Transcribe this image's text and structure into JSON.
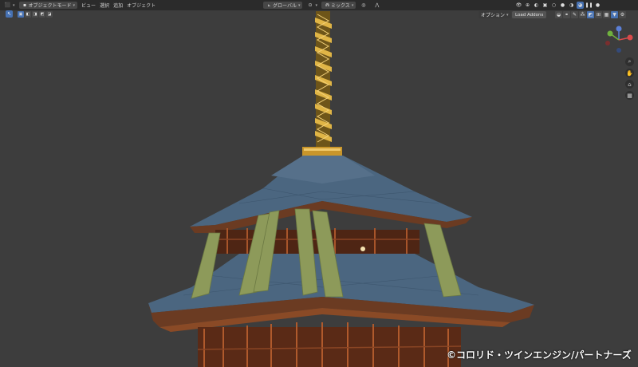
{
  "header": {
    "mode_label": "オブジェクトモード",
    "menus": [
      "ビュー",
      "選択",
      "追加",
      "オブジェクト"
    ],
    "transform_orientation": "グローバル",
    "snap_label": "ミックス"
  },
  "toolbar": {
    "options_label": "オプション",
    "load_addons_label": "Load Addons"
  },
  "watermark": {
    "copyright": "©コロリド・ツインエンジン/パートナーズ"
  },
  "colors": {
    "viewport_bg": "#3d3d3d",
    "header_bg": "#2b2b2b",
    "active_blue": "#4772b3",
    "roof_tile": "#4b6680",
    "timber": "#7a3a1f",
    "gold": "#d4a534",
    "banner": "#8d9a5a"
  },
  "icons": {
    "editor_type": "cube-icon",
    "gizmo_axes": [
      "x-axis-icon",
      "y-axis-icon",
      "z-axis-icon"
    ],
    "nav": [
      "zoom-icon",
      "pan-hand-icon",
      "camera-icon",
      "grid-icon"
    ]
  }
}
